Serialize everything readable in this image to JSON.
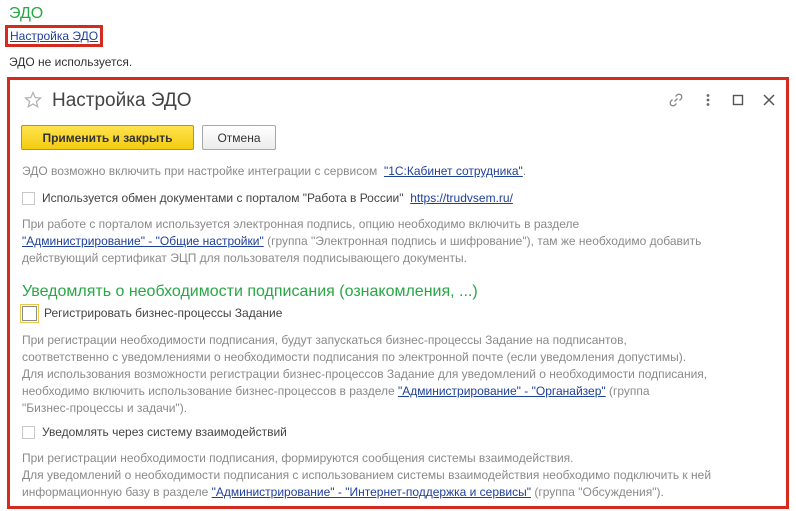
{
  "page": {
    "section_title": "ЭДО",
    "settings_link": "Настройка ЭДО",
    "status_text": "ЭДО не используется."
  },
  "dialog": {
    "title": "Настройка ЭДО",
    "apply_button": "Применить и закрыть",
    "cancel_button": "Отмена",
    "intro_text": "ЭДО возможно включить при настройке интеграции с сервисом",
    "intro_link": "\"1С:Кабинет сотрудника\"",
    "intro_end": ".",
    "portal_checkbox_label": "Используется обмен документами с порталом \"Работа в России\"",
    "portal_link": "https://trudvsem.ru/",
    "portal_info_1": "При работе с порталом используется электронная подпись, опцию необходимо включить в разделе",
    "portal_info_2_link": "\"Администрирование\" - \"Общие настройки\"",
    "portal_info_2_rest": " (группа \"Электронная подпись и шифрование\"), там же необходимо добавить",
    "portal_info_3": "действующий сертификат ЭЦП для пользователя подписывающего документы.",
    "notify_section_title": "Уведомлять о необходимости подписания (ознакомления, ...)",
    "bp_checkbox_label": "Регистрировать бизнес-процессы Задание",
    "bp_info_1": "При регистрации необходимости подписания, будут запускаться бизнес-процессы Задание на подписантов,",
    "bp_info_2": "соответственно с уведомлениями о необходимости подписания по электронной почте (если уведомления допустимы).",
    "bp_info_3": "Для использования возможности регистрации бизнес-процессов Задание для уведомлений о необходимости подписания,",
    "bp_info_4_pre": "необходимо включить использование бизнес-процессов в разделе ",
    "bp_info_4_link": "\"Администрирование\" - \"Органайзер\"",
    "bp_info_4_rest": " (группа",
    "bp_info_5": "\"Бизнес-процессы и задачи\").",
    "interaction_checkbox_label": "Уведомлять через систему взаимодействий",
    "int_info_1": "При регистрации необходимости подписания, формируются сообщения системы взаимодействия.",
    "int_info_2": "Для уведомлений о необходимости подписания с использованием системы взаимодействия необходимо подключить к ней",
    "int_info_3_pre": "информационную базу в разделе ",
    "int_info_3_link": "\"Администрирование\" - \"Интернет-поддержка и сервисы\"",
    "int_info_3_rest": " (группа \"Обсуждения\")."
  },
  "colors": {
    "accent_green": "#28a745",
    "link_blue": "#20419a",
    "highlight_red": "#d52b1e",
    "primary_button": "#f4cc11"
  }
}
